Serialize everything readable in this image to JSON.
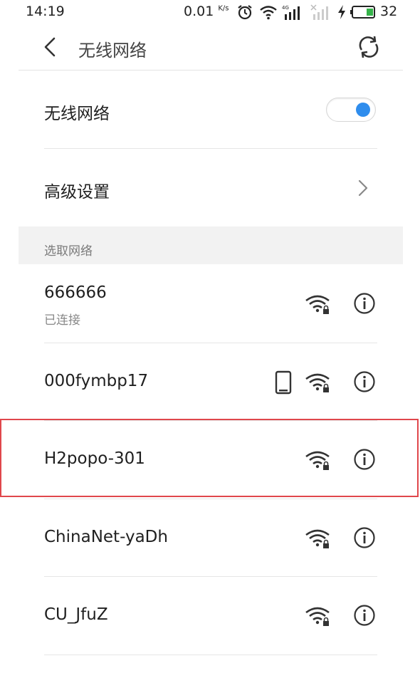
{
  "status_bar": {
    "time": "14:19",
    "speed": "0.01",
    "speed_unit": "K/s",
    "battery_level": "32",
    "icons": [
      "alarm-icon",
      "wifi-icon",
      "signal-4g-icon",
      "signal-empty-icon",
      "charging-icon",
      "battery-icon"
    ]
  },
  "header": {
    "title": "无线网络",
    "back_icon": "chevron-left-icon",
    "refresh_icon": "refresh-icon"
  },
  "settings": {
    "wifi_label": "无线网络",
    "wifi_enabled": true,
    "advanced_label": "高级设置"
  },
  "section": {
    "label": "选取网络"
  },
  "networks": [
    {
      "name": "666666",
      "status": "已连接",
      "secured": true,
      "phone_hotspot": false,
      "highlighted": false
    },
    {
      "name": "000fymbp17",
      "status": "",
      "secured": true,
      "phone_hotspot": true,
      "highlighted": false
    },
    {
      "name": "H2popo-301",
      "status": "",
      "secured": true,
      "phone_hotspot": false,
      "highlighted": true
    },
    {
      "name": "ChinaNet-yaDh",
      "status": "",
      "secured": true,
      "phone_hotspot": false,
      "highlighted": false
    },
    {
      "name": "CU_JfuZ",
      "status": "",
      "secured": true,
      "phone_hotspot": false,
      "highlighted": false
    }
  ],
  "colors": {
    "accent": "#2f8ded",
    "highlight_border": "#e0474c",
    "section_bg": "#f2f2f2"
  }
}
